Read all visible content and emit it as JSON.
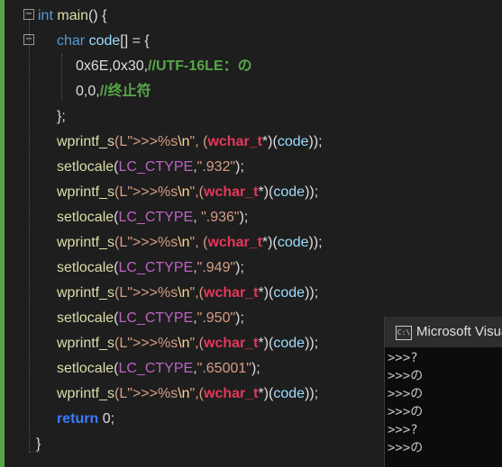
{
  "code": {
    "l1": {
      "kw": "int",
      "fn": "main",
      "rest": "() {"
    },
    "l2": {
      "kw": "char",
      "var": "code",
      "rest": "[] = {"
    },
    "l3": {
      "num": "0x6E,0x30,",
      "comment": "//UTF-16LE：の"
    },
    "l4": {
      "num": "0,0,",
      "comment": "//终止符"
    },
    "l5": {
      "text": "};"
    },
    "wprintf_fn": "wprintf_s",
    "setlocale_fn": "setlocale",
    "lc": "LC_CTYPE",
    "fmt_prefix": "(L\">>>%s",
    "esc_n": "\\n",
    "fmt_suffix_spaced": "\", (",
    "fmt_suffix_tight": "\",(",
    "wchar": "wchar_t",
    "cast_tail": "*)(",
    "code_var": "code",
    "close": "));",
    "loc": [
      {
        "sep": ",",
        "val": "\".932\""
      },
      {
        "sep": ", ",
        "val": "\".936\""
      },
      {
        "sep": ",",
        "val": "\".949\""
      },
      {
        "sep": ",",
        "val": "\".950\""
      },
      {
        "sep": ",",
        "val": "\".65001\""
      }
    ],
    "paren_open": "(",
    "paren_close": ");",
    "return_kw": "return",
    "return_val": "0;",
    "closing_brace": "}"
  },
  "console": {
    "title": "Microsoft Visual Studio Debug Console",
    "lines": [
      ">>>?",
      ">>>の",
      ">>>の",
      ">>>の",
      ">>>?",
      ">>>の"
    ]
  },
  "icons": {
    "fold": "collapse-icon",
    "console": "console-icon"
  }
}
